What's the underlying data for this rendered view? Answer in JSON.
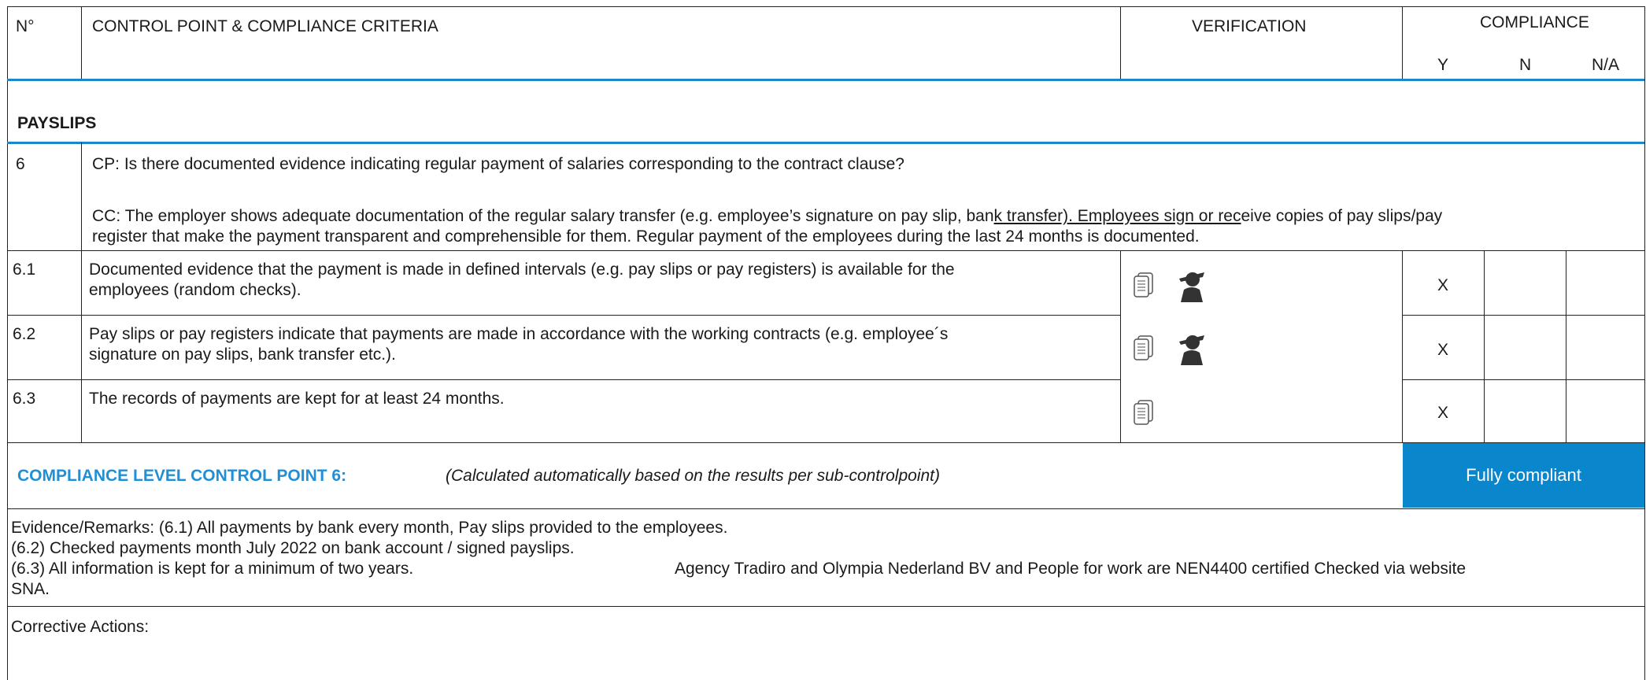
{
  "header": {
    "no": "N°",
    "control_point": "CONTROL POINT & COMPLIANCE CRITERIA",
    "verification": "VERIFICATION",
    "compliance": "COMPLIANCE",
    "y": "Y",
    "n": "N",
    "na": "N/A"
  },
  "section": {
    "title": "PAYSLIPS",
    "number": "6",
    "cp": "CP: Is there documented evidence indicating regular payment of salaries corresponding to the contract clause?",
    "cc_line1_a": "CC: The employer shows adequate documentation of the regular salary transfer (e.g. employee’s signature on pay slip, ban",
    "cc_line1_b": "k transfer). Employees sign or rec",
    "cc_line1_c": "eive copies of pay slips/pay",
    "cc_line2": "register that make the payment transparent and comprehensible for them. Regular payment of the employees during the last 24 months is documented."
  },
  "rows": [
    {
      "id": "6.1",
      "line1": "Documented evidence that the payment is made in defined intervals (e.g. pay slips or pay registers) is available for the",
      "line2": "employees (random checks).",
      "icons": [
        "document-icon",
        "person-icon"
      ],
      "y": "X",
      "n": "",
      "na": ""
    },
    {
      "id": "6.2",
      "line1": "Pay slips or pay registers indicate that payments are made in accordance with the working contracts (e.g. employee´s",
      "line2": "signature on pay slips, bank transfer etc.).",
      "icons": [
        "document-icon",
        "person-icon"
      ],
      "y": "X",
      "n": "",
      "na": ""
    },
    {
      "id": "6.3",
      "line1": "The records of payments are kept for at least 24 months.",
      "line2": "",
      "icons": [
        "document-icon"
      ],
      "y": "X",
      "n": "",
      "na": ""
    }
  ],
  "compliance_level": {
    "label": "COMPLIANCE LEVEL CONTROL POINT 6:",
    "note": "(Calculated automatically based on the results per sub-controlpoint)",
    "result": "Fully compliant",
    "label_color": "#1f8fd6",
    "badge_color": "#0a86cd"
  },
  "evidence": {
    "line1": "Evidence/Remarks: (6.1) All payments by bank every month, Pay slips provided to the employees.",
    "line2": "(6.2) Checked payments month July 2022  on bank account / signed payslips.",
    "line3a": "(6.3) All information is kept for a minimum of two years.",
    "line3b": "Agency Tradiro and Olympia Nederland BV and People for work are  NEN4400 certified  Checked via website",
    "line4": "SNA."
  },
  "corrective": {
    "label": "Corrective Actions:"
  }
}
